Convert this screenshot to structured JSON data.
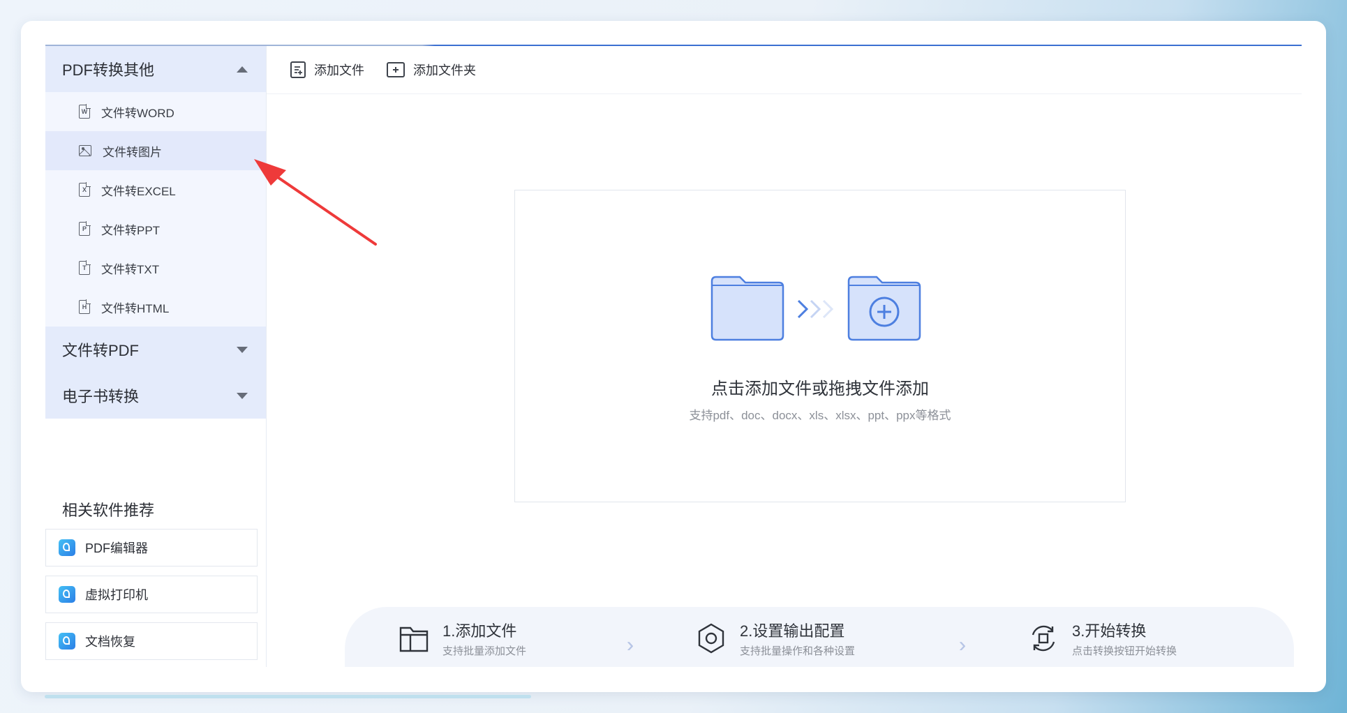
{
  "sidebar": {
    "group_pdf": {
      "label": "PDF转换其他"
    },
    "items": [
      {
        "label": "文件转WORD",
        "icon": "W"
      },
      {
        "label": "文件转图片",
        "icon": "image"
      },
      {
        "label": "文件转EXCEL",
        "icon": "X"
      },
      {
        "label": "文件转PPT",
        "icon": "P"
      },
      {
        "label": "文件转TXT",
        "icon": "T"
      },
      {
        "label": "文件转HTML",
        "icon": "H"
      }
    ],
    "group_to_pdf": {
      "label": "文件转PDF"
    },
    "group_ebook": {
      "label": "电子书转换"
    },
    "recommend": {
      "title": "相关软件推荐",
      "apps": [
        {
          "label": "PDF编辑器"
        },
        {
          "label": "虚拟打印机"
        },
        {
          "label": "文档恢复"
        }
      ]
    }
  },
  "toolbar": {
    "add_file": "添加文件",
    "add_folder": "添加文件夹"
  },
  "dropzone": {
    "title": "点击添加文件或拖拽文件添加",
    "subtitle": "支持pdf、doc、docx、xls、xlsx、ppt、ppx等格式"
  },
  "steps": [
    {
      "title": "1.添加文件",
      "desc": "支持批量添加文件"
    },
    {
      "title": "2.设置输出配置",
      "desc": "支持批量操作和各种设置"
    },
    {
      "title": "3.开始转换",
      "desc": "点击转换按钮开始转换"
    }
  ],
  "colors": {
    "accent": "#3b6fd1",
    "annotation_arrow": "#ee3a3a",
    "folder_fill": "#d6e2fb",
    "folder_stroke": "#4d7fe0"
  }
}
